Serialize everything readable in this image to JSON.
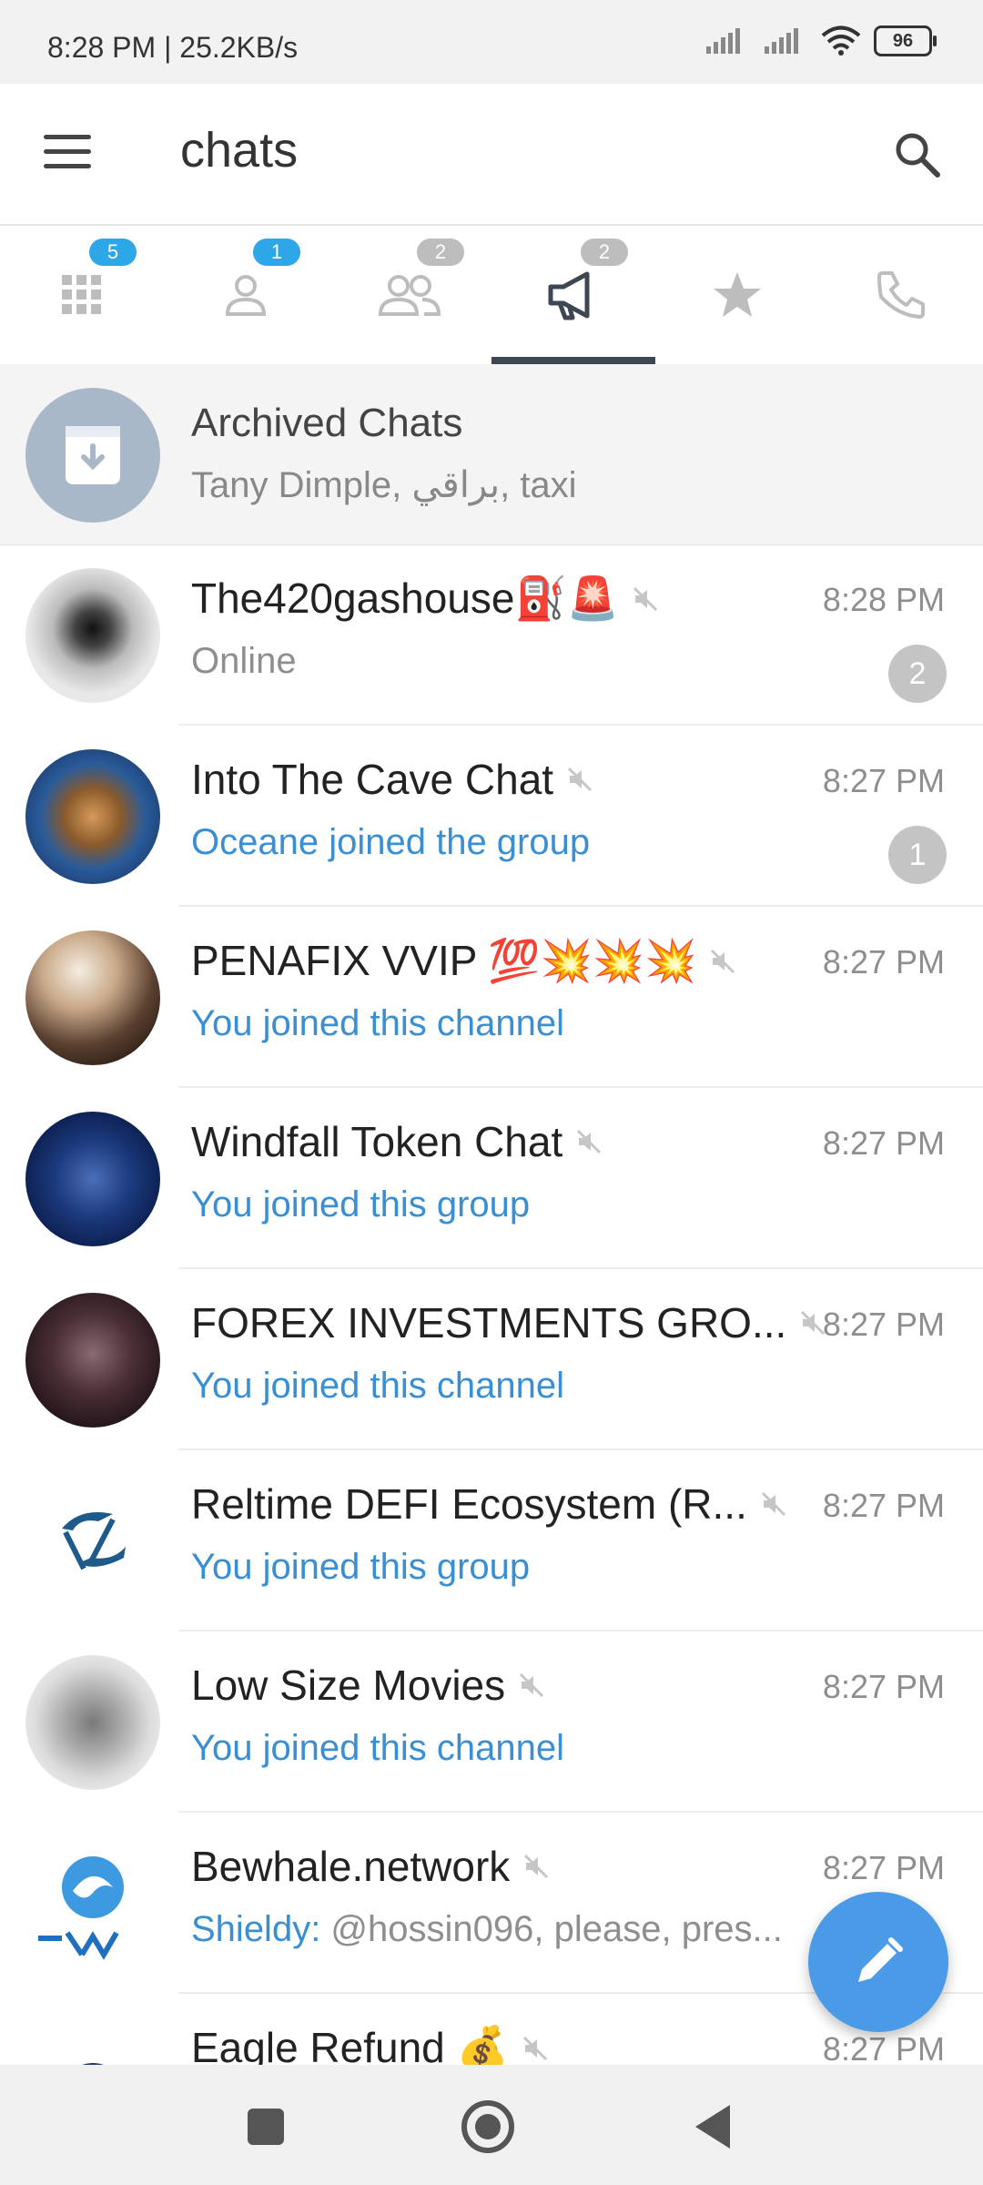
{
  "status_bar": {
    "time": "8:28 PM | 25.2KB/s",
    "battery": "96"
  },
  "app_bar": {
    "title": "chats"
  },
  "tabs": [
    {
      "icon": "grid-icon",
      "badge": "5",
      "badge_color": "#2ea7e8",
      "active": false
    },
    {
      "icon": "person-icon",
      "badge": "1",
      "badge_color": "#2ea7e8",
      "active": false
    },
    {
      "icon": "people-icon",
      "badge": "2",
      "badge_color": "#bdbdbd",
      "active": false
    },
    {
      "icon": "megaphone-icon",
      "badge": "2",
      "badge_color": "#bdbdbd",
      "active": true
    },
    {
      "icon": "star-icon",
      "badge": "",
      "active": false
    },
    {
      "icon": "phone-icon",
      "badge": "",
      "active": false
    }
  ],
  "archived": {
    "title": "Archived Chats",
    "subtitle": "Tany Dimple, براقي, taxi"
  },
  "chats": [
    {
      "name": "The420gashouse⛽🚨",
      "time": "8:28 PM",
      "message": "Online",
      "message_style": "gray",
      "unread": "2"
    },
    {
      "name": "Into The Cave Chat",
      "time": "8:27 PM",
      "message": "Oceane joined the group",
      "message_style": "blue",
      "unread": "1"
    },
    {
      "name": "PENAFIX VVIP 💯💥💥💥",
      "time": "8:27 PM",
      "message": "You joined this channel",
      "message_style": "blue",
      "unread": ""
    },
    {
      "name": "Windfall Token Chat",
      "time": "8:27 PM",
      "message": "You joined this group",
      "message_style": "blue",
      "unread": ""
    },
    {
      "name": "FOREX INVESTMENTS GRO...",
      "time": "8:27 PM",
      "message": "You joined this channel",
      "message_style": "blue",
      "unread": ""
    },
    {
      "name": "Reltime DEFI Ecosystem (R...",
      "time": "8:27 PM",
      "message": "You joined this group",
      "message_style": "blue",
      "unread": ""
    },
    {
      "name": "Low Size Movies",
      "time": "8:27 PM",
      "message": "You joined this channel",
      "message_style": "blue",
      "unread": ""
    },
    {
      "name": "Bewhale.network",
      "time": "8:27 PM",
      "message_sender": "Shieldy:",
      "message": " @hossin096, please, pres...",
      "message_style": "sender",
      "unread": ""
    },
    {
      "name": "Eagle Refund 💰",
      "time": "8:27 PM",
      "message": "",
      "message_style": "blue",
      "unread": ""
    }
  ],
  "colors": {
    "accent": "#3a8fd2",
    "fab": "#4b9ae8",
    "archive_avatar": "#a9b8c8"
  }
}
